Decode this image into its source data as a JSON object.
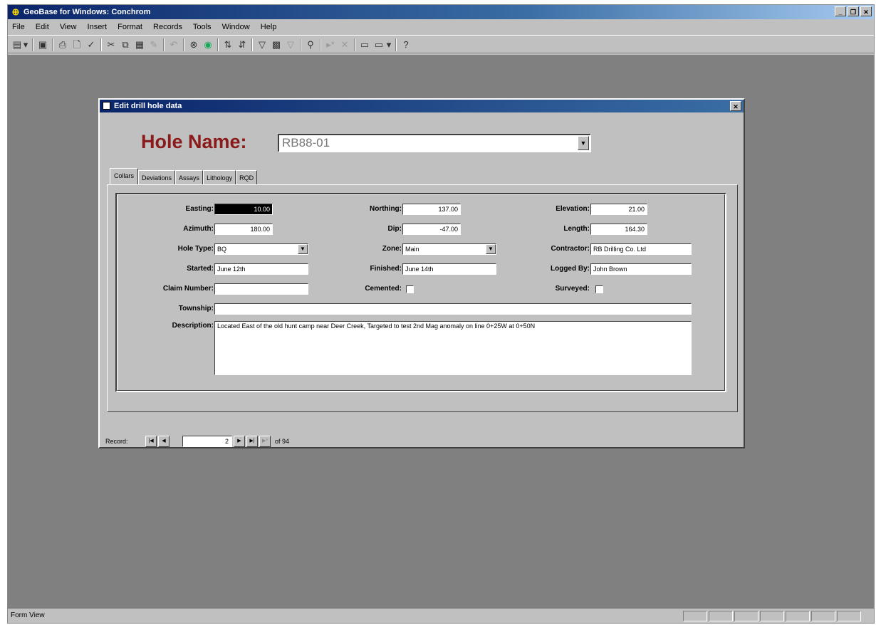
{
  "app": {
    "title": "GeoBase for Windows: Conchrom",
    "menu": [
      "File",
      "Edit",
      "View",
      "Insert",
      "Format",
      "Records",
      "Tools",
      "Window",
      "Help"
    ],
    "status_text": "Form View"
  },
  "form": {
    "title": "Edit drill hole data",
    "hole_name_label": "Hole Name:",
    "hole_name_value": "RB88-01",
    "tabs": [
      "Collars",
      "Deviations",
      "Assays",
      "Lithology",
      "RQD"
    ],
    "active_tab": "Collars",
    "fields": {
      "easting": {
        "label": "Easting:",
        "value": "10.00"
      },
      "northing": {
        "label": "Northing:",
        "value": "137.00"
      },
      "elevation": {
        "label": "Elevation:",
        "value": "21.00"
      },
      "azimuth": {
        "label": "Azimuth:",
        "value": "180.00"
      },
      "dip": {
        "label": "Dip:",
        "value": "-47.00"
      },
      "length": {
        "label": "Length:",
        "value": "164.30"
      },
      "hole_type": {
        "label": "Hole Type:",
        "value": "BQ"
      },
      "zone": {
        "label": "Zone:",
        "value": "Main"
      },
      "contractor": {
        "label": "Contractor:",
        "value": "RB Drilling Co. Ltd"
      },
      "started": {
        "label": "Started:",
        "value": "June 12th"
      },
      "finished": {
        "label": "Finished:",
        "value": "June 14th"
      },
      "logged_by": {
        "label": "Logged By:",
        "value": "John Brown"
      },
      "claim_number": {
        "label": "Claim Number:",
        "value": ""
      },
      "cemented": {
        "label": "Cemented:",
        "checked": false
      },
      "surveyed": {
        "label": "Surveyed:",
        "checked": false
      },
      "township": {
        "label": "Township:",
        "value": ""
      },
      "description": {
        "label": "Description:",
        "value": "Located East of the old hunt camp near Deer Creek, Targeted to test 2nd Mag anomaly on line 0+25W at 0+50N"
      }
    },
    "navigation": {
      "record_label": "Record:",
      "current_record": "2",
      "of_label": "of 94"
    }
  }
}
